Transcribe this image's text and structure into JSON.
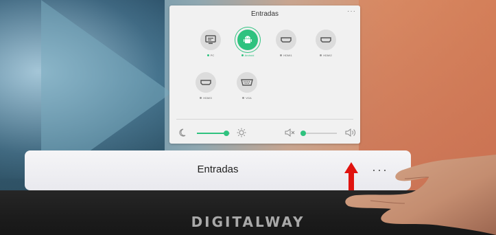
{
  "panel": {
    "title": "Entradas",
    "more_label": "···",
    "sources": [
      {
        "label": "PC",
        "icon": "pc-icon",
        "active": false
      },
      {
        "label": "Android",
        "icon": "android-icon",
        "active": true
      },
      {
        "label": "HDMI1",
        "icon": "hdmi-icon",
        "active": false
      },
      {
        "label": "HDMI2",
        "icon": "hdmi-icon",
        "active": false
      },
      {
        "label": "HDMI3",
        "icon": "hdmi-icon",
        "active": false
      },
      {
        "label": "VGA",
        "icon": "vga-icon",
        "active": false
      }
    ],
    "brightness": 0.9,
    "volume": 0.05
  },
  "taskbar": {
    "title": "Entradas",
    "more_label": "···"
  },
  "bezel": {
    "brand": "DIGITALWAY"
  },
  "colors": {
    "accent": "#2fc27f",
    "arrow": "#e0130f"
  }
}
